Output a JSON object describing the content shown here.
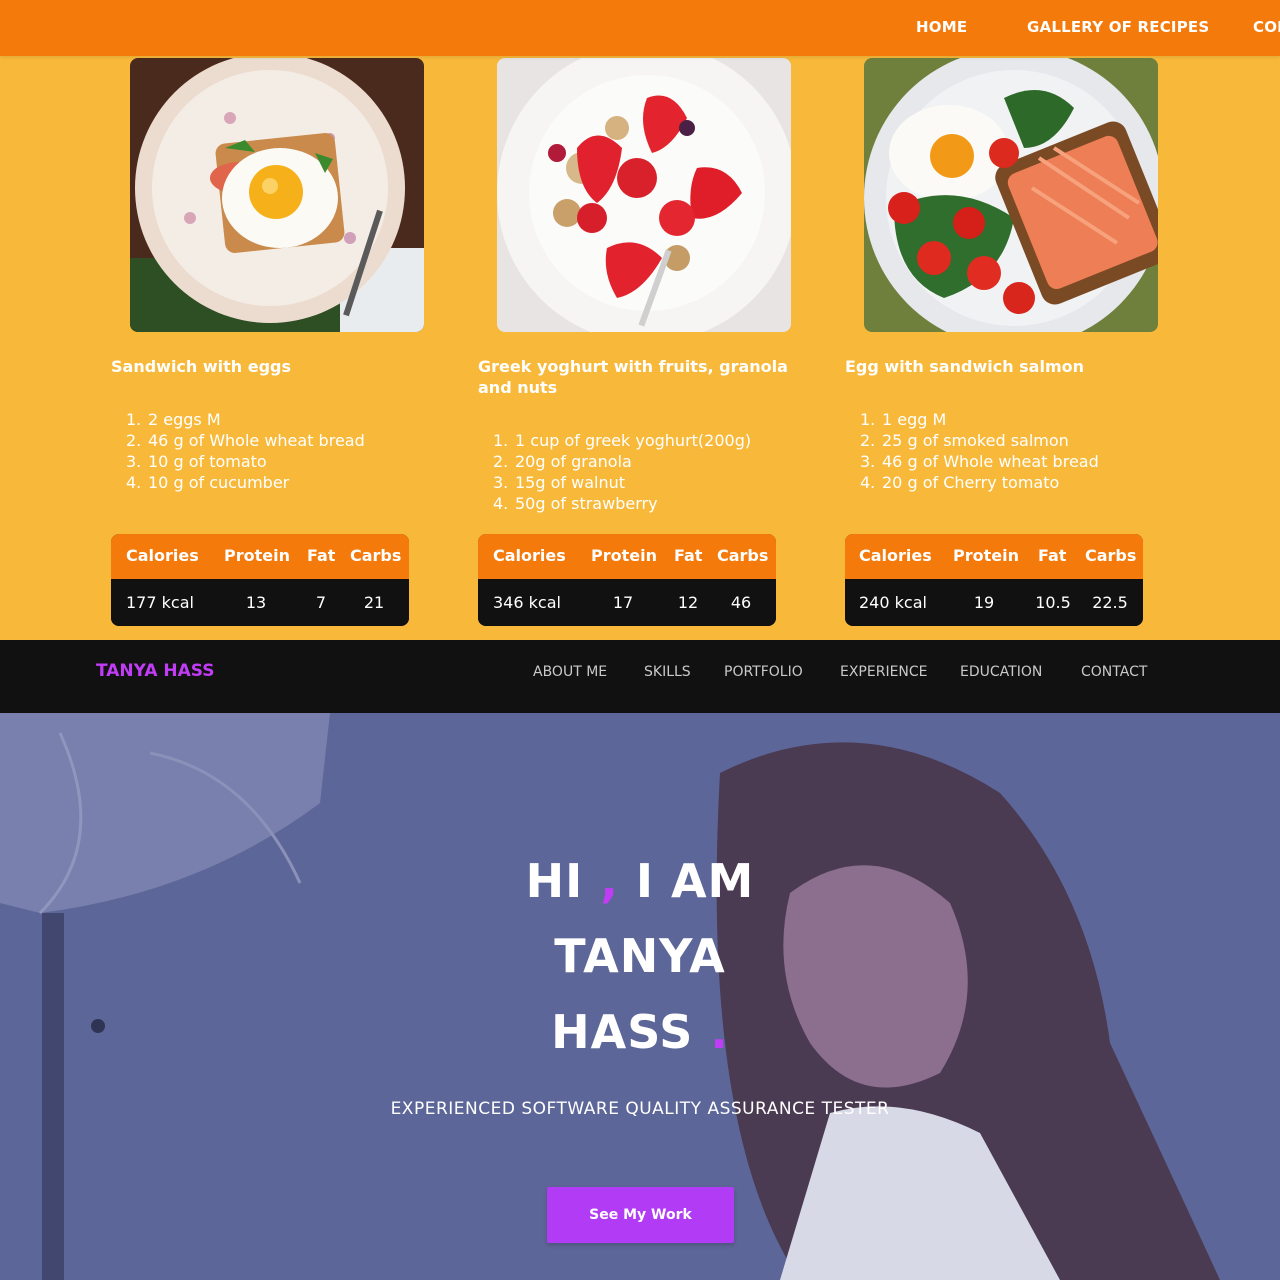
{
  "recipe_site": {
    "nav": {
      "home": "HOME",
      "gallery": "GALLERY OF RECIPES",
      "contact_partial": "CON"
    },
    "nutrition_headers": [
      "Calories",
      "Protein",
      "Fat",
      "Carbs"
    ],
    "recipes": [
      {
        "photo": "fried-egg-sandwich-photo",
        "title": "Sandwich with eggs",
        "ingredients": [
          {
            "num": "1.",
            "text": "2 eggs M"
          },
          {
            "num": "2.",
            "text": "46 g of Whole wheat bread"
          },
          {
            "num": "3.",
            "text": "10 g of tomato"
          },
          {
            "num": "4.",
            "text": "10 g of cucumber"
          }
        ],
        "nutrition": {
          "calories": "177 kcal",
          "protein": "13",
          "fat": "7",
          "carbs": "21"
        }
      },
      {
        "photo": "greek-yoghurt-strawberry-photo",
        "title": "Greek yoghurt with fruits, granola and nuts",
        "ingredients": [
          {
            "num": "1.",
            "text": "1 cup of greek yoghurt(200g)"
          },
          {
            "num": "2.",
            "text": "20g of granola"
          },
          {
            "num": "3.",
            "text": "15g of walnut"
          },
          {
            "num": "4.",
            "text": "50g of strawberry"
          }
        ],
        "nutrition": {
          "calories": "346 kcal",
          "protein": "17",
          "fat": "12",
          "carbs": "46"
        }
      },
      {
        "photo": "egg-salmon-sandwich-photo",
        "title": "Egg with sandwich salmon",
        "ingredients": [
          {
            "num": "1.",
            "text": "1 egg M"
          },
          {
            "num": "2.",
            "text": "25 g of smoked salmon"
          },
          {
            "num": "3.",
            "text": "46 g of Whole wheat bread"
          },
          {
            "num": "4.",
            "text": "20 g of Cherry tomato"
          }
        ],
        "nutrition": {
          "calories": "240 kcal",
          "protein": "19",
          "fat": "10.5",
          "carbs": "22.5"
        }
      }
    ],
    "colors": {
      "nav": "#f57a0c",
      "background": "#f8b93a",
      "table_body": "#111111"
    }
  },
  "portfolio": {
    "logo": "TANYA HASS",
    "nav": [
      "ABOUT ME",
      "SKILLS",
      "PORTFOLIO",
      "EXPERIENCE",
      "EDUCATION",
      "CONTACT"
    ],
    "hero": {
      "line1_a": "HI",
      "line1_comma": ",",
      "line1_b": "I AM",
      "line2": "TANYA",
      "line3": "HASS",
      "line3_dot": ".",
      "subtitle": "EXPERIENCED SOFTWARE QUALITY ASSURANCE TESTER",
      "cta": "See My Work",
      "background_photo": "woman-working-photo"
    },
    "colors": {
      "accent": "#c03cf5",
      "nav": "#111111",
      "overlay": "#5a6294",
      "button": "#b23cf6"
    }
  }
}
